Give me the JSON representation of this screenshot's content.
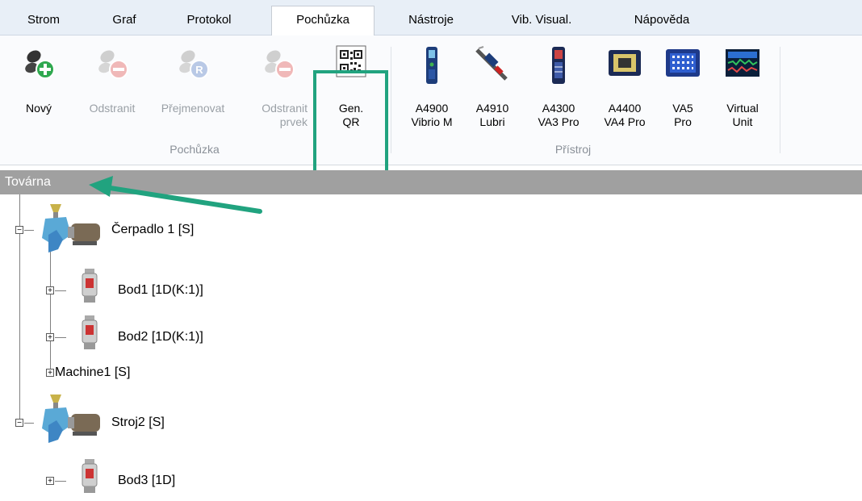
{
  "menu": {
    "tabs": [
      {
        "label": "Strom"
      },
      {
        "label": "Graf"
      },
      {
        "label": "Protokol"
      },
      {
        "label": "Pochůzka"
      },
      {
        "label": "Nástroje"
      },
      {
        "label": "Vib. Visual."
      },
      {
        "label": "Nápověda"
      }
    ],
    "active": "Pochůzka"
  },
  "ribbon": {
    "groups": [
      {
        "label": "Pochůzka"
      },
      {
        "label": "Přístroj"
      }
    ],
    "buttons": [
      {
        "label": "Nový",
        "icon": "new-route-icon"
      },
      {
        "label": "Odstranit",
        "icon": "remove-route-icon"
      },
      {
        "label": "Přejmenovat",
        "icon": "rename-route-icon"
      },
      {
        "label": "Odstranit\nprvek",
        "icon": "remove-item-icon"
      },
      {
        "label": "Gen.\nQR",
        "icon": "qr-code-icon"
      },
      {
        "label": "A4900\nVibrio M",
        "icon": "device-a4900-icon"
      },
      {
        "label": "A4910\nLubri",
        "icon": "device-a4910-icon"
      },
      {
        "label": "A4300\nVA3 Pro",
        "icon": "device-a4300-icon"
      },
      {
        "label": "A4400\nVA4 Pro",
        "icon": "device-a4400-icon"
      },
      {
        "label": "VA5\nPro",
        "icon": "device-va5-icon"
      },
      {
        "label": "Virtual\nUnit",
        "icon": "virtual-unit-icon"
      }
    ]
  },
  "tree": {
    "header": "Továrna",
    "nodes": [
      {
        "label": "Čerpadlo 1 [S]",
        "icon": "machine-icon"
      },
      {
        "label": "Bod1 [1D(K:1)]",
        "icon": "sensor-icon"
      },
      {
        "label": "Bod2 [1D(K:1)]",
        "icon": "sensor-icon"
      },
      {
        "label": "Machine1 [S]",
        "icon": ""
      },
      {
        "label": "Stroj2 [S]",
        "icon": "machine-icon"
      },
      {
        "label": "Bod3 [1D]",
        "icon": "sensor-icon"
      }
    ]
  },
  "colors": {
    "highlight": "#21a37f",
    "arrow": "#21a37f",
    "header_bg": "#a0a0a0"
  }
}
